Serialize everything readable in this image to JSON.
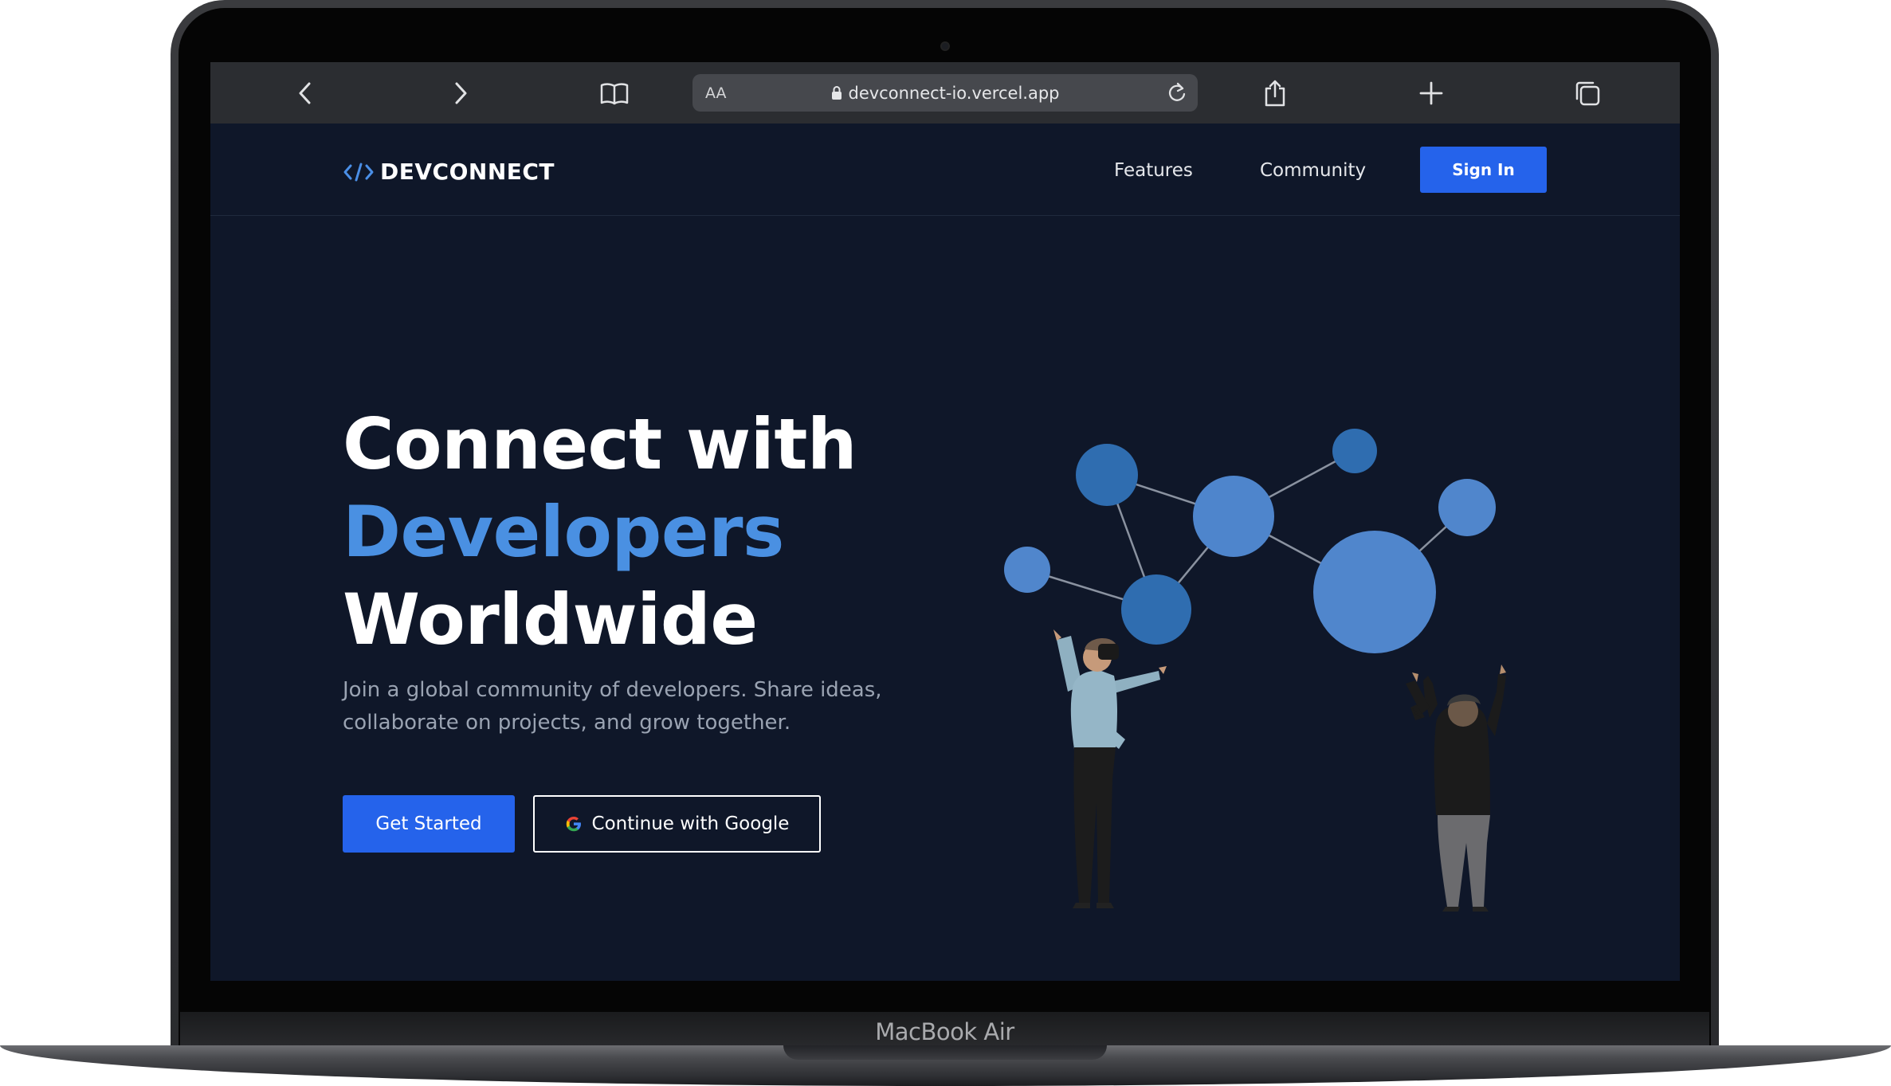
{
  "device": {
    "model_label": "MacBook Air"
  },
  "browser": {
    "text_size_label": "AA",
    "url": "devconnect-io.vercel.app",
    "buttons": [
      "back",
      "forward",
      "bookmarks",
      "reload",
      "share",
      "new-tab",
      "tabs"
    ]
  },
  "site": {
    "logo_symbol": "</>",
    "logo_text": "DEVCONNECT",
    "nav": {
      "features": "Features",
      "community": "Community",
      "sign_in": "Sign In"
    },
    "hero": {
      "line1": "Connect with",
      "line2": "Developers",
      "line3": "Worldwide",
      "subtitle": "Join a global community of developers. Share ideas, collaborate on projects, and grow together.",
      "cta_primary": "Get Started",
      "cta_google": "Continue with Google"
    }
  },
  "colors": {
    "page_bg": "#0f1729",
    "accent": "#4a90e2",
    "button": "#2563eb",
    "node_dark": "#2f6db0",
    "node_light": "#5086cc"
  }
}
